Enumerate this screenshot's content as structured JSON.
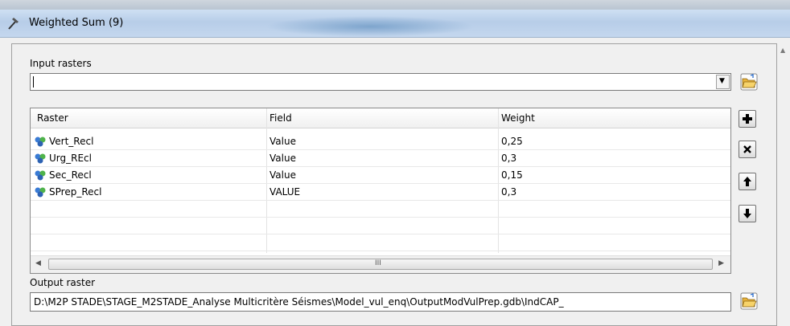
{
  "window": {
    "title": "Weighted Sum (9)"
  },
  "input_rasters": {
    "label": "Input rasters",
    "value": ""
  },
  "table": {
    "headers": [
      "Raster",
      "Field",
      "Weight"
    ],
    "rows": [
      {
        "raster": "Vert_Recl",
        "field": "Value",
        "weight": "0,25"
      },
      {
        "raster": "Urg_REcl",
        "field": "Value",
        "weight": "0,3"
      },
      {
        "raster": "Sec_Recl",
        "field": "Value",
        "weight": "0,15"
      },
      {
        "raster": "SPrep_Recl",
        "field": "VALUE",
        "weight": "0,3"
      }
    ],
    "scroll_grip": "III"
  },
  "output_raster": {
    "label": "Output raster",
    "value": "D:\\M2P STADE\\STAGE_M2STADE_Analyse Multicritère Séismes\\Model_vul_enq\\OutputModVulPrep.gdb\\IndCAP_"
  },
  "icons": {
    "title": "hammer-icon",
    "browse": "folder-open-icon",
    "add": "plus-icon",
    "remove": "x-icon",
    "up": "arrow-up-icon",
    "down": "arrow-down-icon",
    "raster": "raster-layer-icon"
  },
  "colors": {
    "folder": "#e8b33a",
    "raster_icon": "#3a7bd5"
  }
}
